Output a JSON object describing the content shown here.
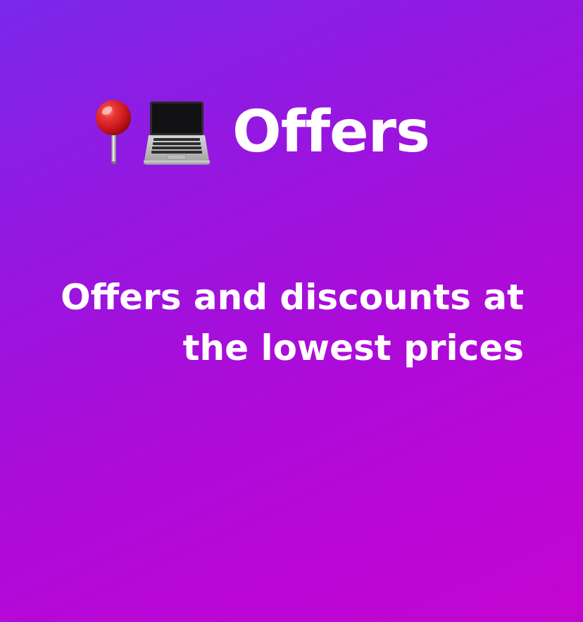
{
  "title": {
    "icons": [
      "pushpin-icon",
      "laptop-icon"
    ],
    "text": "Offers"
  },
  "subtitle": {
    "lines": [
      "Offers and discounts at",
      "the lowest prices"
    ]
  },
  "colors": {
    "background_start": "#7a28ec",
    "background_end": "#c405d0",
    "text": "#ffffff",
    "pin_head": "#d81d24"
  }
}
